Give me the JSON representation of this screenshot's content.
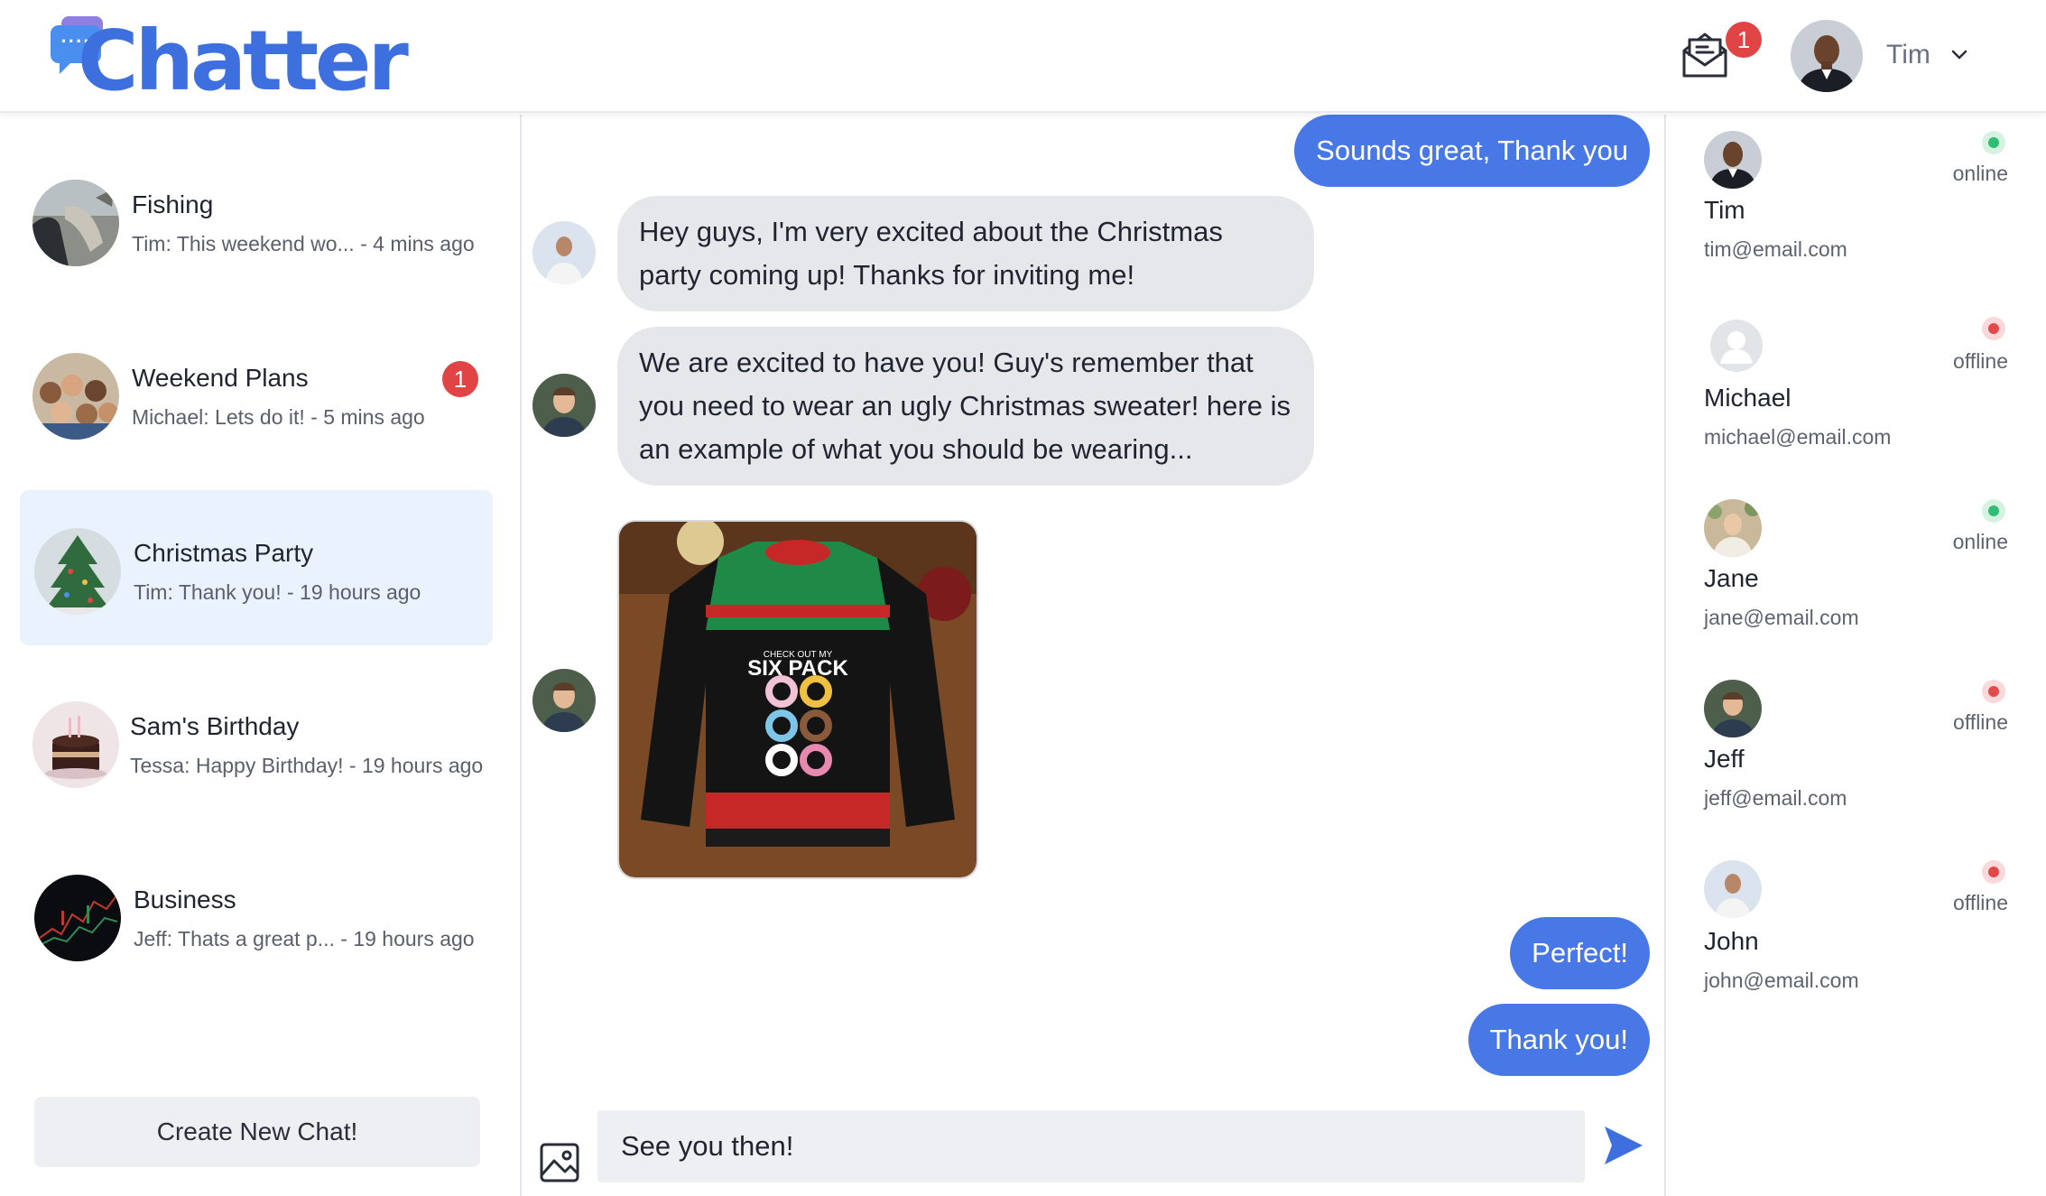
{
  "app": {
    "logo_text": "Chatter"
  },
  "header": {
    "notification_count": "1",
    "user_name": "Tim"
  },
  "sidebar": {
    "chats": [
      {
        "title": "Fishing",
        "preview": "Tim: This weekend wo... - 4 mins ago",
        "badge": ""
      },
      {
        "title": "Weekend Plans",
        "preview": "Michael: Lets do it! - 5 mins ago",
        "badge": "1"
      },
      {
        "title": "Christmas Party",
        "preview": "Tim: Thank you! - 19 hours ago",
        "badge": ""
      },
      {
        "title": "Sam's Birthday",
        "preview": "Tessa: Happy Birthday! - 19 hours ago",
        "badge": ""
      },
      {
        "title": "Business",
        "preview": "Jeff: Thats a great p... - 19 hours ago",
        "badge": ""
      }
    ],
    "create_button": "Create New Chat!"
  },
  "messages": {
    "items": [
      {
        "text": "Sounds great, Thank you"
      },
      {
        "text": "Hey guys, I'm very excited about the Christmas party coming up! Thanks for inviting me!"
      },
      {
        "text": "We are excited to have you! Guy's remember that you need to wear an ugly Christmas sweater! here is an example of what you should be wearing..."
      },
      {
        "image_caption": "CHECK OUT MY",
        "image_title": "SIX PACK"
      },
      {
        "text": "Perfect!"
      },
      {
        "text": "Thank you!"
      }
    ]
  },
  "composer": {
    "value": "See you then!"
  },
  "members": [
    {
      "name": "Tim",
      "email": "tim@email.com",
      "status": "online"
    },
    {
      "name": "Michael",
      "email": "michael@email.com",
      "status": "offline"
    },
    {
      "name": "Jane",
      "email": "jane@email.com",
      "status": "online"
    },
    {
      "name": "Jeff",
      "email": "jeff@email.com",
      "status": "offline"
    },
    {
      "name": "John",
      "email": "john@email.com",
      "status": "offline"
    }
  ],
  "colors": {
    "brand": "#3d6fde",
    "my_bubble": "#4778e6",
    "their_bubble": "#e6e7eb",
    "badge": "#e04444",
    "online": "#2fbf73",
    "offline": "#e24a4a"
  }
}
